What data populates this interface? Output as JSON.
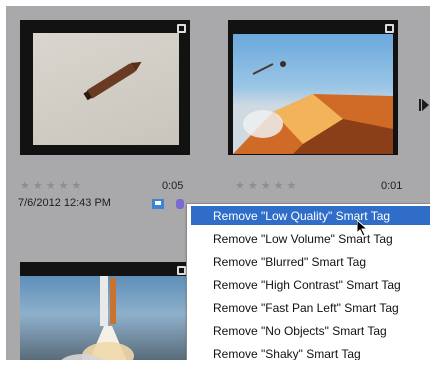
{
  "thumbnails": [
    {
      "duration": "0:05",
      "date": "7/6/2012 12:43 PM",
      "stars": "★★★★★"
    },
    {
      "duration": "0:01",
      "stars": "★★★★★"
    }
  ],
  "context_menu": {
    "items": [
      "Remove \"Low Quality\" Smart Tag",
      "Remove \"Low Volume\" Smart Tag",
      "Remove \"Blurred\" Smart Tag",
      "Remove \"High Contrast\" Smart Tag",
      "Remove \"Fast Pan Left\" Smart Tag",
      "Remove \"No Objects\" Smart Tag",
      "Remove \"Shaky\" Smart Tag"
    ],
    "highlighted_index": 0
  },
  "colors": {
    "background": "#a9a9ab",
    "highlight": "#2f6dc9",
    "tag_icon": "#3d83d2"
  },
  "icons": [
    "film-badge-icon",
    "smart-tag-icon",
    "next-arrow-icon",
    "mouse-cursor-icon"
  ]
}
